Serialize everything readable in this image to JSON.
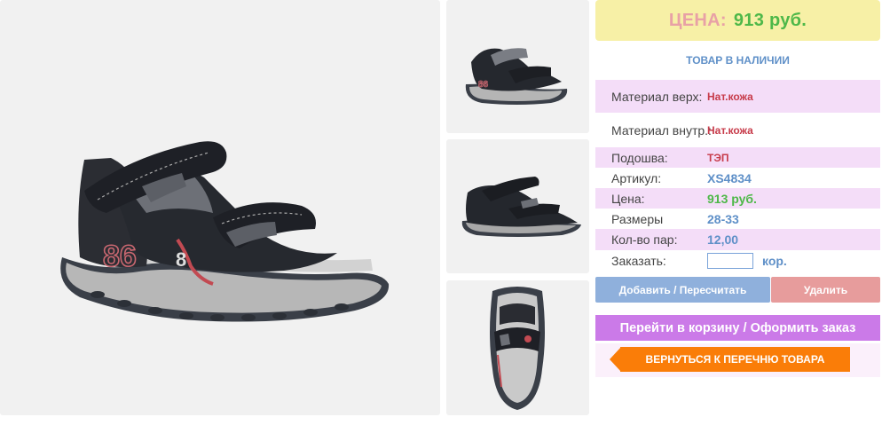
{
  "gallery": {
    "main_alt": "black-sandal",
    "thumbs": [
      "sandal-angle-view",
      "sandal-side-view",
      "sandal-top-view"
    ]
  },
  "price": {
    "label": "ЦЕНА:",
    "value": "913 руб."
  },
  "stock_status": "ТОВАР В НАЛИЧИИ",
  "specs": [
    {
      "label": "Материал верх:",
      "value": "Нат.кожа"
    },
    {
      "label": "Материал внутр.:",
      "value": "Нат.кожа"
    },
    {
      "label": "Подошва:",
      "value": "ТЭП"
    },
    {
      "label": "Артикул:",
      "value": "XS4834"
    },
    {
      "label": "Цена:",
      "value": "913 руб."
    },
    {
      "label": "Размеры",
      "value": "28-33"
    },
    {
      "label": "Кол-во пар:",
      "value": "12,00"
    }
  ],
  "order": {
    "label": "Заказать:",
    "value": "",
    "unit": "кор."
  },
  "buttons": {
    "add": "Добавить / Пересчитать",
    "delete": "Удалить",
    "cart": "Перейти в корзину / Оформить заказ",
    "back": "ВЕРНУТЬСЯ К ПЕРЕЧНЮ ТОВАРА"
  },
  "colors": {
    "price_bg": "#f7f0a6",
    "price_label": "#e8a1a6",
    "price_value": "#4eb849",
    "accent_blue": "#5f90c8",
    "accent_red": "#c73b4a",
    "row_pink": "#f4ddf8",
    "btn_add": "#8fb0dc",
    "btn_delete": "#e79c9c",
    "btn_cart": "#cb7ae8",
    "btn_back": "#fa7d08"
  }
}
